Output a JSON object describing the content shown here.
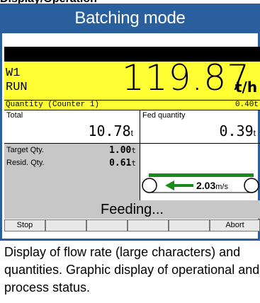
{
  "page_heading": "Display/Operation",
  "banner_title": "Batching mode",
  "main": {
    "scale_id": "W1",
    "state": "RUN",
    "flow_rate": "119.87",
    "flow_unit": "t/h",
    "counter_label": "Quantity (Counter 1)",
    "counter_value": "0.40t"
  },
  "totals": {
    "total_label": "Total",
    "total_value": "10.78",
    "total_unit": "t",
    "fed_label": "Fed quantity",
    "fed_value": "0.39",
    "fed_unit": "t"
  },
  "targets": {
    "target_label": "Target Qty.",
    "target_value": "1.00",
    "target_unit": "t",
    "resid_label": "Resid. Qty.",
    "resid_value": "0.61",
    "resid_unit": "t"
  },
  "belt": {
    "speed_value": "2.03",
    "speed_unit": "m/s",
    "colors": {
      "belt": "#1a8a1a",
      "arrow": "#1a8a1a"
    },
    "icons": [
      "roller-left-icon",
      "arrow-left-icon",
      "roller-right-icon"
    ]
  },
  "status_text": "Feeding...",
  "softkeys": [
    "Stop",
    "",
    "",
    "",
    "",
    "Abort"
  ],
  "caption": "Display of flow rate (large characters) and quantities. Graphic display of operational and process status.",
  "colors": {
    "banner": "#2a5f9e",
    "highlight": "#ffff33",
    "status_bar": "#c7c7c7"
  }
}
